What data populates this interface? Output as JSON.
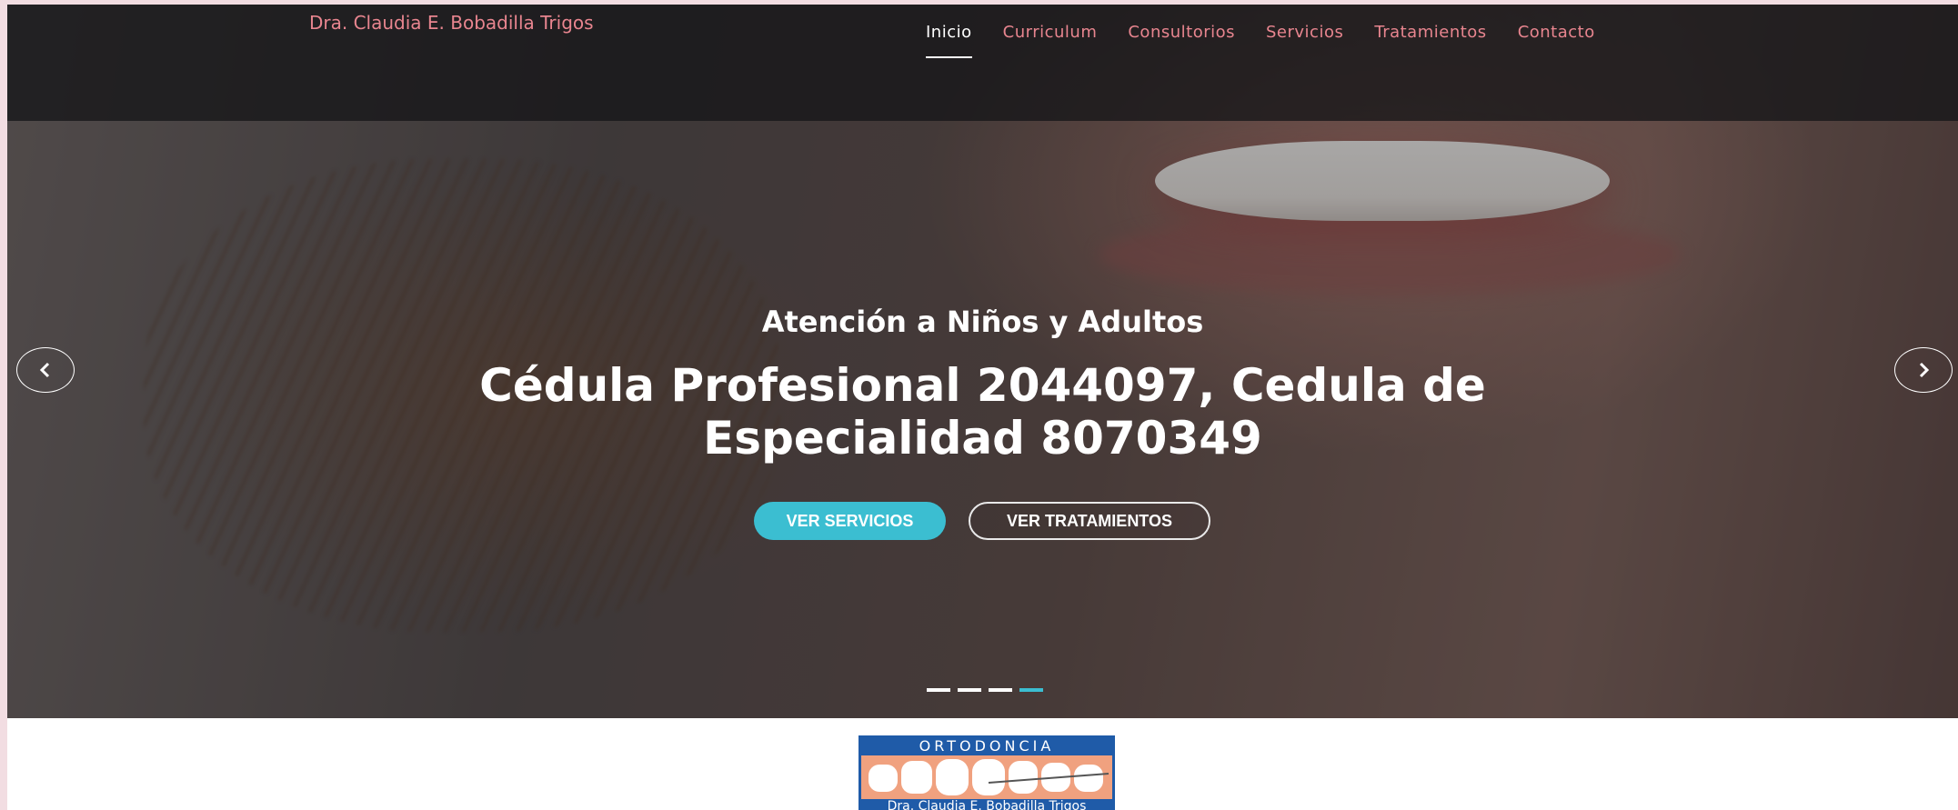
{
  "header": {
    "brand": "Dra. Claudia E. Bobadilla Trigos",
    "nav": [
      {
        "label": "Inicio",
        "active": true
      },
      {
        "label": "Curriculum",
        "active": false
      },
      {
        "label": "Consultorios",
        "active": false
      },
      {
        "label": "Servicios",
        "active": false
      },
      {
        "label": "Tratamientos",
        "active": false
      },
      {
        "label": "Contacto",
        "active": false
      }
    ]
  },
  "hero": {
    "subtitle": "Atención a Niños y Adultos",
    "title_line1": "Cédula Profesional 2044097, Cedula de",
    "title_line2": "Especialidad 8070349",
    "primary_button": "VER SERVICIOS",
    "secondary_button": "VER TRATAMIENTOS",
    "prev_icon": "chevron-left-icon",
    "next_icon": "chevron-right-icon",
    "slide_count": 4,
    "active_slide": 4
  },
  "logo": {
    "top_text": "ORTODONCIA",
    "bottom_text": "Dra. Claudia E. Bobadilla Trigos"
  },
  "colors": {
    "accent": "#3bbed1",
    "brand_pink": "#e8858f",
    "logo_blue": "#1f5ba8"
  }
}
